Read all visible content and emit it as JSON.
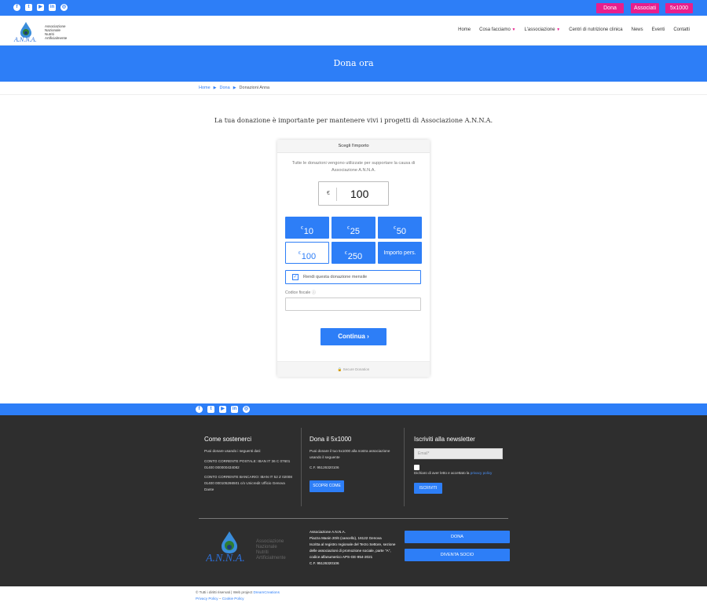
{
  "topbar": {
    "social_icons": [
      "facebook-icon",
      "twitter-icon",
      "youtube-icon",
      "linkedin-icon",
      "instagram-icon"
    ],
    "buttons": {
      "dona": "Dona",
      "associati": "Associati",
      "cinque_per_mille": "5x1000"
    }
  },
  "header": {
    "logo_text": "A.N.N.A.",
    "logo_sub": [
      "Associazione",
      "Nazionale",
      "Nutriti",
      "Artificialmente"
    ],
    "nav": [
      "Home",
      "Cosa facciamo",
      "L'associazione",
      "Centri di nutrizione clinica",
      "News",
      "Eventi",
      "Contatti"
    ]
  },
  "hero": {
    "title": "Dona ora"
  },
  "breadcrumb": {
    "items": [
      "Home",
      "Dona",
      "Donazioni Anna"
    ]
  },
  "intro": "La tua donazione è importante per mantenere vivi i progetti di Associazione A.N.N.A.",
  "donation": {
    "header": "Scegli l'importo",
    "description": "Tutte le donazioni vengono utilizzate per supportare la causa di Associazione A.N.N.A.",
    "currency": "€",
    "amount": "100",
    "options": [
      "10",
      "25",
      "50",
      "100",
      "250"
    ],
    "custom_label": "Importo pers.",
    "selected": "100",
    "monthly_label": "Rendi questa donazione mensile",
    "monthly_checked": true,
    "cf_label": "Codice fiscale",
    "cf_value": "",
    "continue_label": "Continua",
    "footer": "Secure Donation"
  },
  "footer": {
    "col1": {
      "title": "Come sostenerci",
      "intro": "Puoi donare usando i seguenti dati:",
      "postal": "CONTO CORRENTE POSTALE: IBAN IT 36 C 07601 01400 000000434082",
      "bank": "CONTO CORRENTE BANCARIO: IBAN IT 52 Z 02008 01400 000105266501 c/o Unicredit Ufficio Genova Dante"
    },
    "col2": {
      "title": "Dona il 5x1000",
      "text": "Puoi donare il tuo 5x1000 alla nostra associazione usando il seguente",
      "cf": "C.F. 95126320106",
      "button": "SCOPRI COME"
    },
    "col3": {
      "title": "Iscriviti alla newsletter",
      "email_placeholder": "Email*",
      "privacy_text": "Dichiaro di aver letto e accettato la",
      "privacy_link": "privacy policy",
      "button": "ISCRIVITI"
    },
    "address": {
      "name": "Associazione A.N.N.A.",
      "lines": [
        "Piazza Manin 20/6 (cancello), 16122 Genova",
        "Iscritta al registro regionale del Terzo Settore, sezione",
        "delle associazioni di promozione sociale, parte \"A\",",
        "codice alfanumerico APS-GE-954-2021",
        "C.F. 95126320106"
      ]
    },
    "buttons": {
      "dona": "DONA",
      "socio": "DIVENTA SOCIO"
    }
  },
  "bottom": {
    "copyright": "© Tutti i diritti riservati | Web project",
    "credit": "DreamCreations",
    "privacy": "Privacy Policy",
    "cookie": "Cookie Policy",
    "dash": "–"
  }
}
